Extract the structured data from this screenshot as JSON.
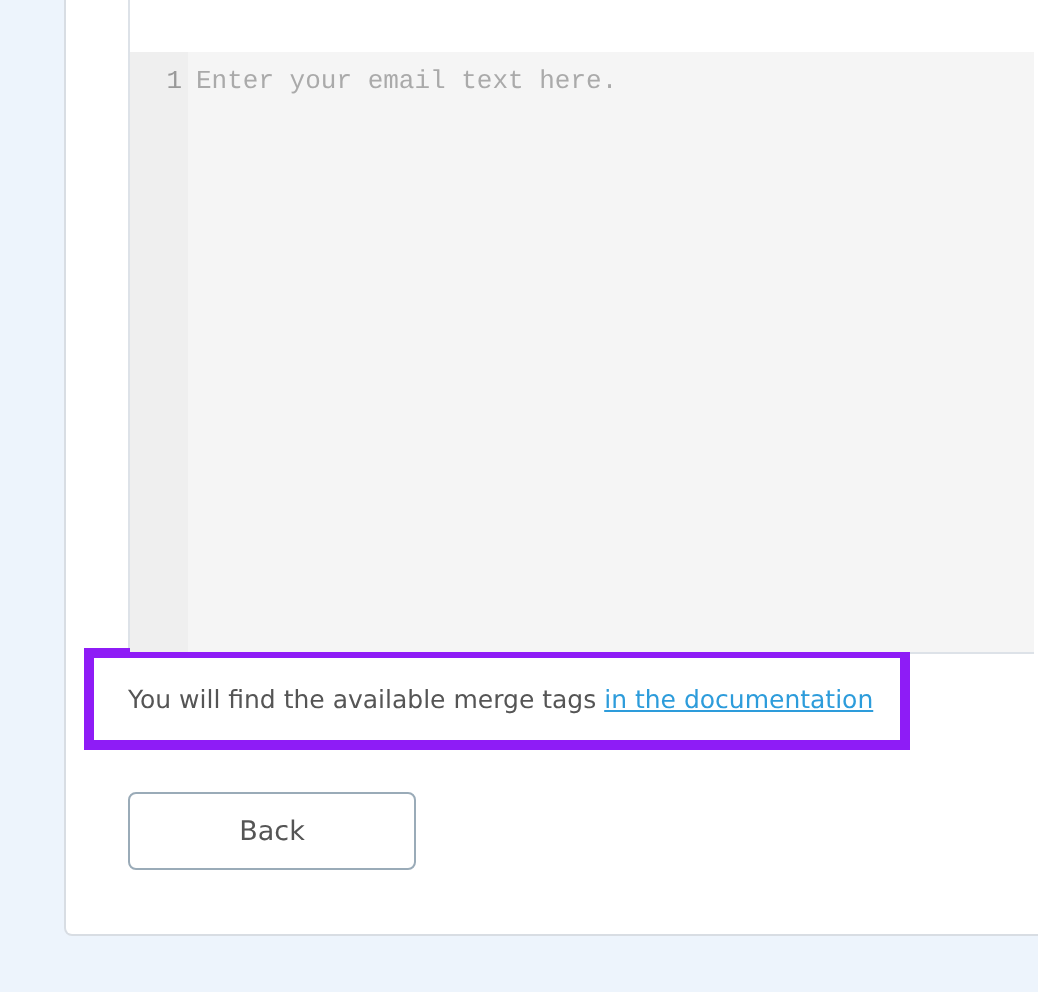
{
  "editor": {
    "line_numbers": [
      "1"
    ],
    "placeholder": "Enter your email text here."
  },
  "note": {
    "text": "You will find the available merge tags",
    "link": "in the documentation",
    "highlighted": true
  },
  "buttons": [
    {
      "label": "Back"
    }
  ]
}
